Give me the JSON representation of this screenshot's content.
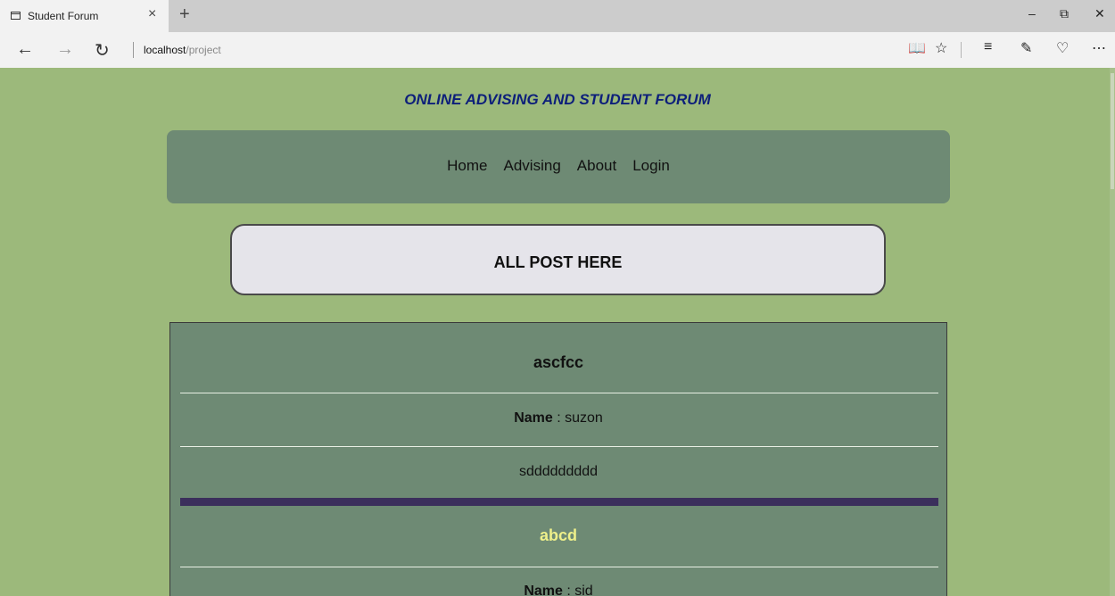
{
  "browser": {
    "tab_title": "Student Forum",
    "close_glyph": "×",
    "new_tab_glyph": "+",
    "url_host": "localhost",
    "url_path": "/project",
    "icons": [
      "back-arrow-icon",
      "forward-arrow-icon",
      "refresh-icon",
      "reading-view-icon",
      "favorite-star-icon",
      "hub-icon",
      "web-note-icon",
      "share-icon",
      "more-icon"
    ]
  },
  "site": {
    "title": "ONLINE ADVISING AND STUDENT FORUM",
    "nav": [
      "Home",
      "Advising",
      "About",
      "Login"
    ],
    "posts_heading": "ALL POST HERE"
  },
  "posts": [
    {
      "title": "ascfcc",
      "name_label": "Name",
      "name": "suzon",
      "body": "sddddddddd",
      "title_color": "#111111"
    },
    {
      "title": "abcd",
      "name_label": "Name",
      "name": "sid",
      "title_color": "#eef08a"
    }
  ]
}
